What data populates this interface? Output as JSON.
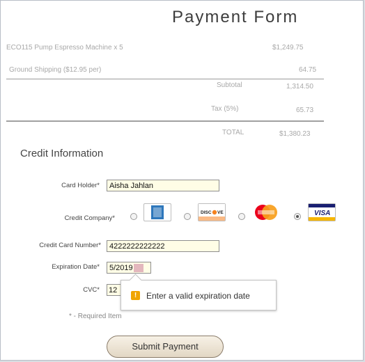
{
  "form": {
    "title": "Payment Form"
  },
  "order": {
    "item_desc": "ECO115 Pump Espresso Machine x 5",
    "item_price": "$1,249.75",
    "shipping_desc": "Ground Shipping ($12.95 per)",
    "shipping_price": "64.75",
    "subtotal_label": "Subtotal",
    "subtotal_value": "1,314.50",
    "tax_label": "Tax (5%)",
    "tax_value": "65.73",
    "total_label": "TOTAL",
    "total_value": "$1,380.23"
  },
  "credit": {
    "heading": "Credit Information",
    "card_holder_label": "Card Holder*",
    "card_holder_value": "Aisha Jahlan",
    "company_label": "Credit Company*",
    "card_brands": [
      "AMERICAN EXPRESS",
      "DISCOVER",
      "MasterCard",
      "VISA"
    ],
    "selected_brand": "VISA",
    "card_number_label": "Credit Card Number*",
    "card_number_value": "4222222222222",
    "expiration_label": "Expiration Date*",
    "expiration_value": "5/2019",
    "cvc_label": "CVC*",
    "cvc_value": "12",
    "required_note": "* - Required Item",
    "submit_label": "Submit Payment"
  },
  "validation": {
    "message": "Enter a valid expiration date",
    "icon": "warning-icon",
    "icon_glyph": "!"
  },
  "colors": {
    "input_bg": "#fffde6",
    "warning": "#f0a500",
    "visa_blue": "#1a1f71",
    "amex_blue": "#2e77bb",
    "mastercard_red": "#eb001b",
    "mastercard_orange": "#f79e1b"
  }
}
